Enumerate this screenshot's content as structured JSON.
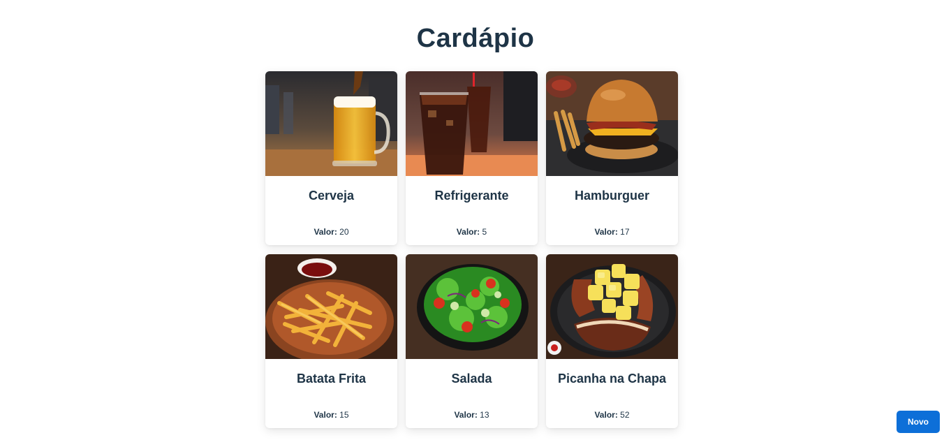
{
  "page": {
    "title": "Cardápio"
  },
  "menu": {
    "price_label": "Valor:",
    "items": [
      {
        "name": "Cerveja",
        "value": "20",
        "image": "beer-photo"
      },
      {
        "name": "Refrigerante",
        "value": "5",
        "image": "soda-photo"
      },
      {
        "name": "Hamburguer",
        "value": "17",
        "image": "burger-photo"
      },
      {
        "name": "Batata Frita",
        "value": "15",
        "image": "fries-photo"
      },
      {
        "name": "Salada",
        "value": "13",
        "image": "salad-photo"
      },
      {
        "name": "Picanha na Chapa",
        "value": "52",
        "image": "picanha-photo"
      }
    ]
  },
  "actions": {
    "new_label": "Novo"
  }
}
